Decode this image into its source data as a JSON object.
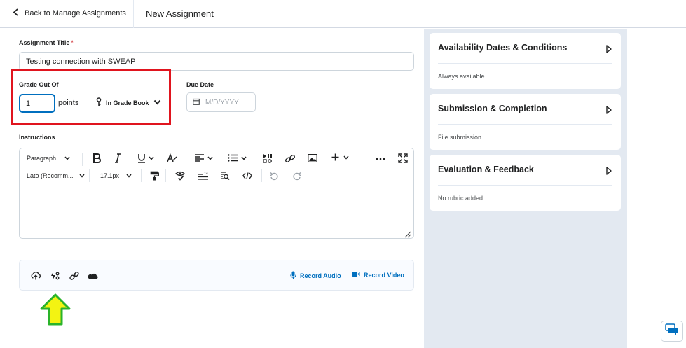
{
  "header": {
    "back_label": "Back to Manage Assignments",
    "page_title": "New Assignment"
  },
  "form": {
    "title_label": "Assignment Title",
    "required_mark": "*",
    "title_value": "Testing connection with SWEAP",
    "grade_label": "Grade Out Of",
    "grade_value": "1",
    "points_label": "points",
    "gradebook_label": "In Grade Book",
    "due_label": "Due Date",
    "due_placeholder": "M/D/YYYY",
    "instructions_label": "Instructions"
  },
  "editor": {
    "paragraph_label": "Paragraph",
    "font_label": "Lato (Recomm...",
    "size_label": "17.1px"
  },
  "attachments": {
    "record_audio": "Record Audio",
    "record_video": "Record Video"
  },
  "sidebar": {
    "cards": [
      {
        "title": "Availability Dates & Conditions",
        "summary": "Always available"
      },
      {
        "title": "Submission & Completion",
        "summary": "File submission"
      },
      {
        "title": "Evaluation & Feedback",
        "summary": "No rubric added"
      }
    ]
  },
  "colors": {
    "accent": "#006fbf",
    "annotation_box": "#e0141e",
    "annotation_arrow_fill": "#f3f312",
    "annotation_arrow_stroke": "#2ab32a",
    "panel_bg": "#e3e9f1"
  }
}
